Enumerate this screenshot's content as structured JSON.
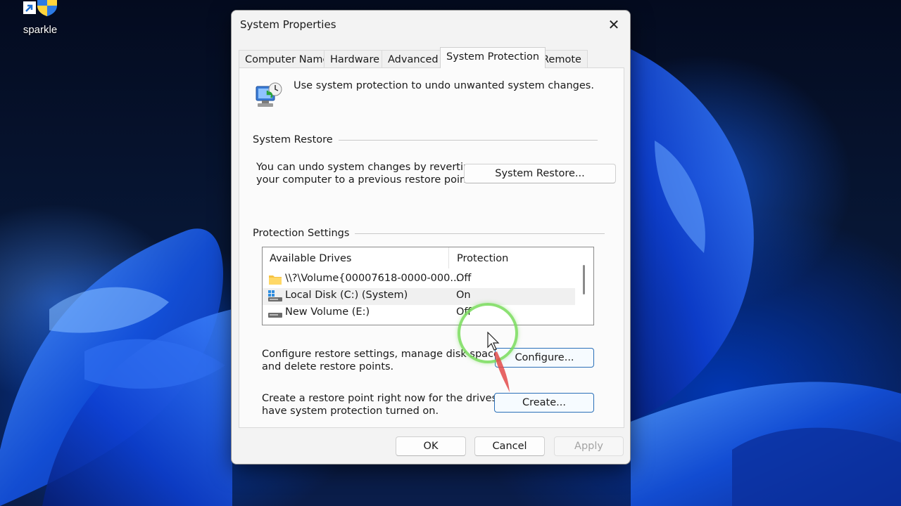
{
  "desktop": {
    "icon_label": "sparkle"
  },
  "dialog": {
    "title": "System Properties",
    "close_glyph": "✕",
    "tabs": [
      {
        "label": "Computer Name"
      },
      {
        "label": "Hardware"
      },
      {
        "label": "Advanced"
      },
      {
        "label": "System Protection",
        "active": true
      },
      {
        "label": "Remote"
      }
    ],
    "intro_text": "Use system protection to undo unwanted system changes.",
    "system_restore": {
      "group_title": "System Restore",
      "description_line1": "You can undo system changes by reverting",
      "description_line2": "your computer to a previous restore point.",
      "button_label": "System Restore..."
    },
    "protection_settings": {
      "group_title": "Protection Settings",
      "columns": [
        "Available Drives",
        "Protection"
      ],
      "drives": [
        {
          "name": "\\\\?\\Volume{00007618-0000-000...",
          "protection": "Off",
          "icon": "folder-icon"
        },
        {
          "name": "Local Disk (C:) (System)",
          "protection": "On",
          "icon": "system-drive-icon",
          "selected": true
        },
        {
          "name": "New Volume (E:)",
          "protection": "Off",
          "icon": "drive-icon"
        }
      ],
      "configure_text_line1": "Configure restore settings, manage disk space,",
      "configure_text_line2": "and delete restore points.",
      "configure_button": "Configure...",
      "create_text_line1": "Create a restore point right now for the drives that",
      "create_text_line2": "have system protection turned on.",
      "create_button": "Create..."
    },
    "footer": {
      "ok": "OK",
      "cancel": "Cancel",
      "apply": "Apply"
    }
  },
  "colors": {
    "wallpaper_blue": "#0a3fd1",
    "focus_border": "#2a6fb8",
    "click_ring": "#78dc5a",
    "pointer_arrow": "#e34a4a"
  }
}
